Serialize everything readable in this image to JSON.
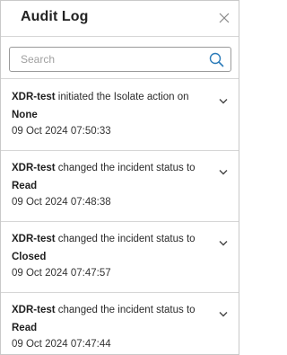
{
  "header": {
    "title": "Audit Log",
    "close_icon": "close-icon"
  },
  "search": {
    "placeholder": "Search",
    "value": "",
    "icon": "search-icon"
  },
  "entries": [
    {
      "actor": "XDR-test",
      "action": " initiated the Isolate action on",
      "target": "None",
      "timestamp": "09 Oct 2024 07:50:33"
    },
    {
      "actor": "XDR-test",
      "action": " changed the incident status to",
      "target": "Read",
      "timestamp": "09 Oct 2024 07:48:38"
    },
    {
      "actor": "XDR-test",
      "action": " changed the incident status to",
      "target": "Closed",
      "timestamp": "09 Oct 2024 07:47:57"
    },
    {
      "actor": "XDR-test",
      "action": " changed the incident status to",
      "target": "Read",
      "timestamp": "09 Oct 2024 07:47:44"
    }
  ],
  "colors": {
    "accent": "#2b7bb9",
    "border": "#d6d6d6",
    "text": "#2b2b2b"
  }
}
